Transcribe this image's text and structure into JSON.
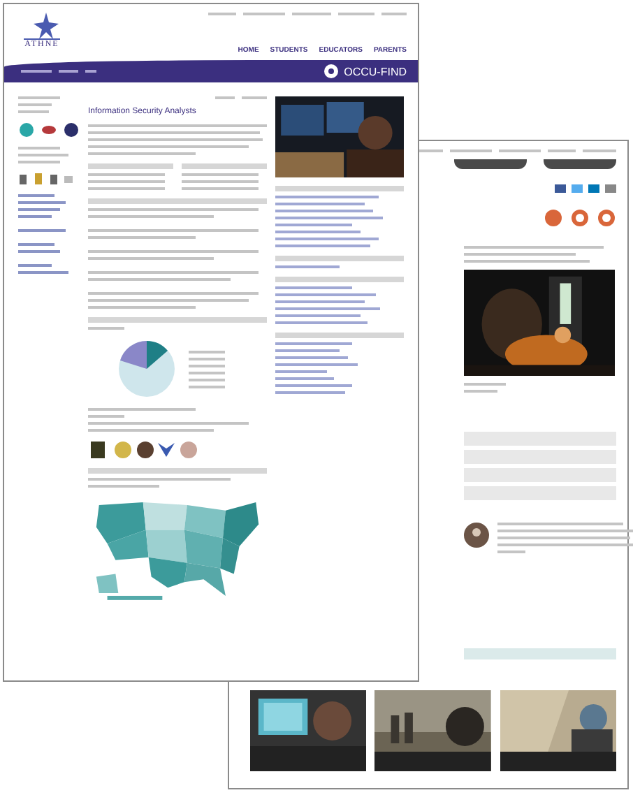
{
  "front_page": {
    "logo": "ATHNE",
    "nav": [
      "HOME",
      "STUDENTS",
      "EDUCATORS",
      "PARENTS"
    ],
    "app_title": "OCCU-FIND",
    "heading": "Information Security Analysts"
  }
}
